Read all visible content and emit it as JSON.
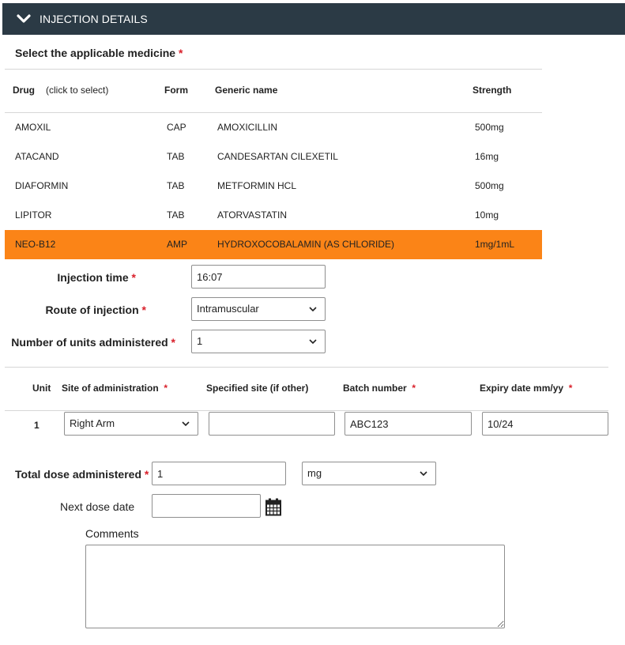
{
  "header": {
    "title": "INJECTION DETAILS"
  },
  "medicine": {
    "prompt": "Select the applicable medicine",
    "required_mark": "*",
    "columns": {
      "drug": "Drug",
      "click_hint": "(click to select)",
      "form": "Form",
      "generic": "Generic name",
      "strength": "Strength"
    },
    "rows": [
      {
        "drug": "AMOXIL",
        "form": "CAP",
        "generic": "AMOXICILLIN",
        "strength": "500mg",
        "selected": false
      },
      {
        "drug": "ATACAND",
        "form": "TAB",
        "generic": "CANDESARTAN CILEXETIL",
        "strength": "16mg",
        "selected": false
      },
      {
        "drug": "DIAFORMIN",
        "form": "TAB",
        "generic": "METFORMIN HCL",
        "strength": "500mg",
        "selected": false
      },
      {
        "drug": "LIPITOR",
        "form": "TAB",
        "generic": "ATORVASTATIN",
        "strength": "10mg",
        "selected": false
      },
      {
        "drug": "NEO-B12",
        "form": "AMP",
        "generic": "HYDROXOCOBALAMIN (AS CHLORIDE)",
        "strength": "1mg/1mL",
        "selected": true
      }
    ],
    "selected_color": "#fb8417"
  },
  "injection": {
    "time_label": "Injection time",
    "time_value": "16:07",
    "route_label": "Route of injection",
    "route_value": "Intramuscular",
    "units_label": "Number of units administered",
    "units_value": "1"
  },
  "units_table": {
    "columns": {
      "unit": "Unit",
      "site": "Site of administration",
      "specified": "Specified site (if other)",
      "batch": "Batch number",
      "expiry": "Expiry date mm/yy"
    },
    "rows": [
      {
        "unit": "1",
        "site": "Right Arm",
        "specified": "",
        "batch": "ABC123",
        "expiry": "10/24"
      }
    ]
  },
  "dose": {
    "total_label": "Total dose administered",
    "total_value": "1",
    "unit_value": "mg",
    "next_label": "Next dose date",
    "next_value": "",
    "calendar_icon": "calendar-icon",
    "comments_label": "Comments",
    "comments_value": ""
  }
}
